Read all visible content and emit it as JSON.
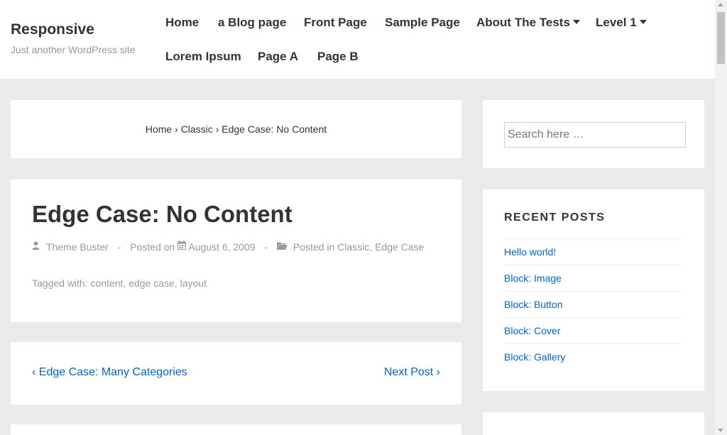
{
  "site": {
    "title": "Responsive",
    "description": "Just another WordPress site"
  },
  "nav": {
    "items": [
      {
        "label": "Home"
      },
      {
        "label": "a Blog page"
      },
      {
        "label": "Front Page"
      },
      {
        "label": "Sample Page"
      },
      {
        "label": "About The Tests"
      },
      {
        "label": "Level 1"
      },
      {
        "label": "Lorem Ipsum"
      },
      {
        "label": "Page A"
      },
      {
        "label": "Page B"
      }
    ]
  },
  "breadcrumb": {
    "home": "Home",
    "sep": "›",
    "category": "Classic",
    "current": "Edge Case: No Content"
  },
  "post": {
    "title": "Edge Case: No Content",
    "author": "Theme Buster",
    "meta_dash": "-",
    "posted_on_label": "Posted on",
    "date": "August 6, 2009",
    "posted_in_label": "Posted in",
    "categories": [
      "Classic",
      "Edge Case"
    ],
    "tagged_label": "Tagged with:",
    "tags": [
      "content",
      "edge case",
      "layout"
    ],
    "list_comma": ","
  },
  "post_nav": {
    "prev": "‹ Edge Case: Many Categories",
    "next": "Next Post ›"
  },
  "sidebar": {
    "search_placeholder": "Search here …",
    "recent_title": "RECENT POSTS",
    "recent_posts": [
      "Hello world!",
      "Block: Image",
      "Block: Button",
      "Block: Cover",
      "Block: Gallery"
    ]
  },
  "icons": {
    "caret": "caret-down-icon",
    "author": "user-icon",
    "date": "calendar-icon",
    "category": "folder-icon"
  },
  "colors": {
    "link": "#0066cc",
    "muted": "#999999",
    "background": "#eaeaea"
  }
}
